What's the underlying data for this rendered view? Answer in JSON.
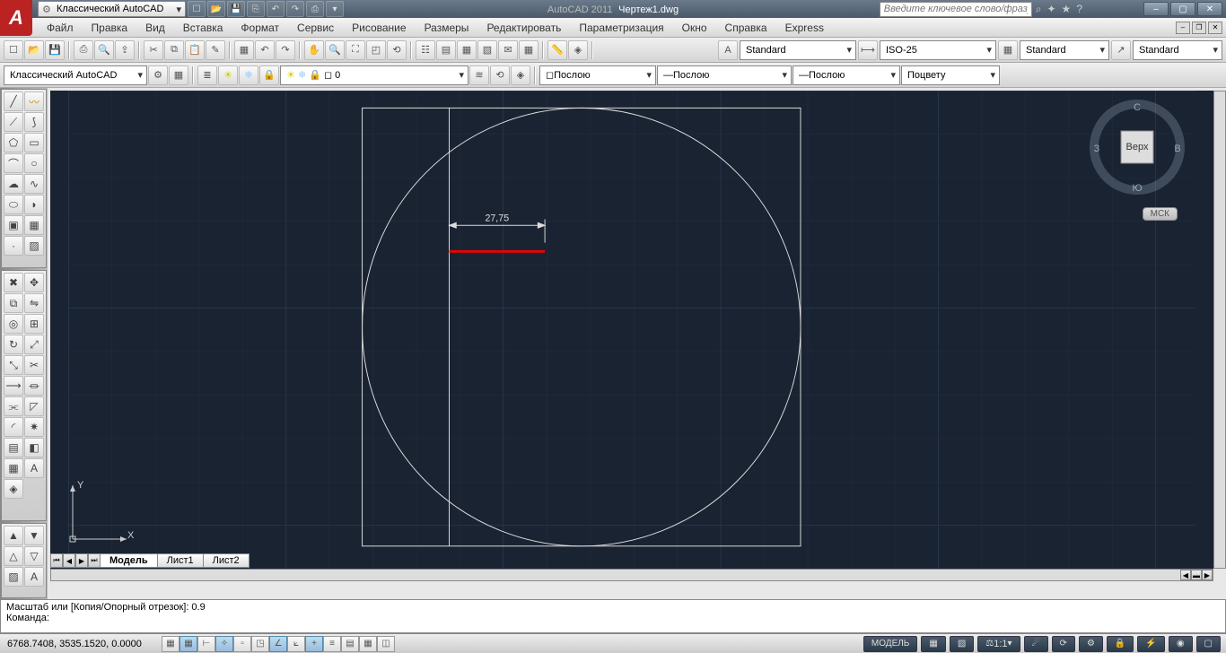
{
  "app": {
    "title_prefix": "AutoCAD 2011",
    "doc": "Чертеж1.dwg"
  },
  "workspace": "Классический AutoCAD",
  "search_placeholder": "Введите ключевое слово/фразу",
  "menu": [
    "Файл",
    "Правка",
    "Вид",
    "Вставка",
    "Формат",
    "Сервис",
    "Рисование",
    "Размеры",
    "Редактировать",
    "Параметризация",
    "Окно",
    "Справка",
    "Express"
  ],
  "toolbar2": {
    "workspace": "Классический AutoCAD",
    "layer": "0"
  },
  "annot": {
    "text_style": "Standard",
    "dim_style": "ISO-25",
    "table_style": "Standard",
    "mleader_style": "Standard"
  },
  "props": {
    "color": "Послою",
    "linetype": "Послою",
    "lineweight": "Послою",
    "plotstyle": "Поцвету"
  },
  "viewcube": {
    "top": "Верх",
    "n": "С",
    "s": "Ю",
    "e": "В",
    "w": "З",
    "wcs": "МСК"
  },
  "tabs": {
    "model": "Модель",
    "l1": "Лист1",
    "l2": "Лист2"
  },
  "cmd": {
    "line1": "Масштаб или [Копия/Опорный отрезок]: 0.9",
    "line2": "Команда:"
  },
  "status": {
    "coords": "6768.7408, 3535.1520, 0.0000",
    "model": "МОДЕЛЬ",
    "scale": "1:1"
  },
  "drawing": {
    "dimension_value": "27,75"
  },
  "ucs": {
    "x": "X",
    "y": "Y"
  },
  "scale_label": "⚖"
}
